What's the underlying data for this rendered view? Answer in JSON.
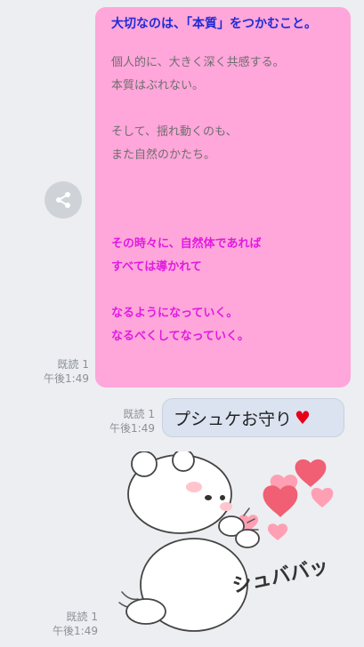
{
  "message1": {
    "headline": "大切なのは、「本質」をつかむこと。",
    "gray_lines": [
      "個人的に、大きく深く共感する。",
      "本質はぶれない。",
      "そして、揺れ動くのも、",
      "また自然のかたち。"
    ],
    "magenta_lines": [
      "その時々に、自然体であれば",
      "すべては導かれて",
      "なるようになっていく。",
      "なるべくしてなっていく。"
    ],
    "read_label": "既読 1",
    "time": "午後1:49"
  },
  "message2": {
    "text": "プシュケお守り",
    "heart": "♥",
    "read_label": "既読 1",
    "time": "午後1:49"
  },
  "message3": {
    "sticker_text": "シュババッ",
    "read_label": "既読 1",
    "time": "午後1:49"
  },
  "icons": {
    "share": "share-icon"
  }
}
